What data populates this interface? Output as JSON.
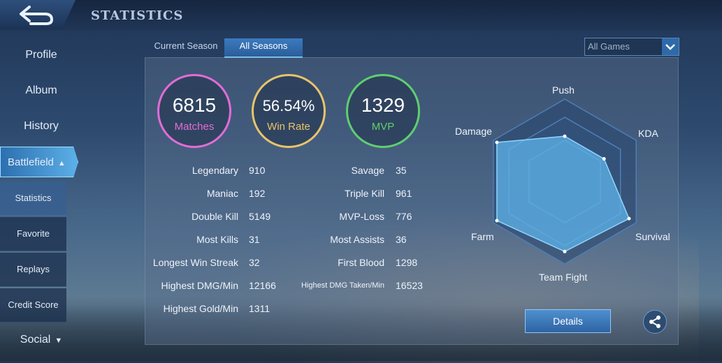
{
  "header": {
    "title": "STATISTICS"
  },
  "sidebar": {
    "items": [
      {
        "label": "Profile"
      },
      {
        "label": "Album"
      },
      {
        "label": "History"
      },
      {
        "label": "Battlefield"
      },
      {
        "label": "Social"
      }
    ],
    "sub_items": [
      {
        "label": "Statistics"
      },
      {
        "label": "Favorite"
      },
      {
        "label": "Replays"
      },
      {
        "label": "Credit Score"
      }
    ]
  },
  "tabs": [
    {
      "label": "Current Season"
    },
    {
      "label": "All Seasons"
    }
  ],
  "filter": {
    "selected": "All Games"
  },
  "summary": {
    "matches": {
      "value": "6815",
      "label": "Matches",
      "color": "#e36cd6"
    },
    "winrate": {
      "value": "56.54%",
      "label": "Win Rate",
      "color": "#e8c46a"
    },
    "mvp": {
      "value": "1329",
      "label": "MVP",
      "color": "#5fcf6f"
    }
  },
  "stats_left": [
    {
      "label": "Legendary",
      "value": "910"
    },
    {
      "label": "Maniac",
      "value": "192"
    },
    {
      "label": "Double Kill",
      "value": "5149"
    },
    {
      "label": "Most Kills",
      "value": "31"
    },
    {
      "label": "Longest Win Streak",
      "value": "32"
    },
    {
      "label": "Highest DMG/Min",
      "value": "12166"
    },
    {
      "label": "Highest Gold/Min",
      "value": "1311"
    }
  ],
  "stats_right": [
    {
      "label": "Savage",
      "value": "35"
    },
    {
      "label": "Triple Kill",
      "value": "961"
    },
    {
      "label": "MVP-Loss",
      "value": "776"
    },
    {
      "label": "Most Assists",
      "value": "36"
    },
    {
      "label": "First Blood",
      "value": "1298"
    },
    {
      "label": "Highest DMG Taken/Min",
      "value": "16523"
    }
  ],
  "radar": {
    "labels": [
      "Push",
      "KDA",
      "Survival",
      "Team Fight",
      "Farm",
      "Damage"
    ],
    "values": [
      0.55,
      0.55,
      0.9,
      0.85,
      0.95,
      0.95
    ]
  },
  "actions": {
    "details": "Details",
    "share_icon": "share-icon"
  }
}
